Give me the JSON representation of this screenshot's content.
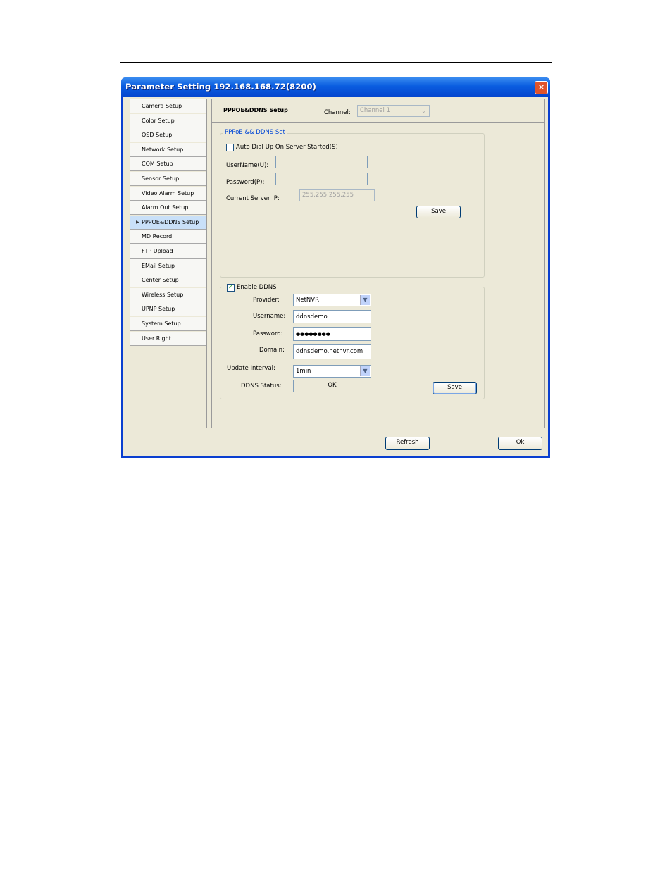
{
  "window": {
    "title": "Parameter Setting 192.168.168.72(8200)"
  },
  "nav": {
    "items": [
      {
        "label": "Camera Setup"
      },
      {
        "label": "Color Setup"
      },
      {
        "label": "OSD Setup"
      },
      {
        "label": "Network Setup"
      },
      {
        "label": "COM Setup"
      },
      {
        "label": "Sensor Setup"
      },
      {
        "label": "Video Alarm Setup"
      },
      {
        "label": "Alarm Out Setup"
      },
      {
        "label": "PPPOE&DDNS Setup"
      },
      {
        "label": "MD Record"
      },
      {
        "label": "FTP Upload"
      },
      {
        "label": "EMail Setup"
      },
      {
        "label": "Center Setup"
      },
      {
        "label": "Wireless Setup"
      },
      {
        "label": "UPNP Setup"
      },
      {
        "label": "System Setup"
      },
      {
        "label": "User Right"
      }
    ],
    "active_index": 8
  },
  "header": {
    "section_title": "PPPOE&DDNS Setup",
    "channel_label": "Channel:",
    "channel_value": "Channel 1"
  },
  "pppoe": {
    "legend": "PPPoE && DDNS Set",
    "auto_dial_label": "Auto Dial Up On Server Started(S)",
    "username_label": "UserName(U):",
    "username_value": "",
    "password_label": "Password(P):",
    "password_value": "",
    "server_ip_label": "Current Server IP:",
    "server_ip_value": "255.255.255.255",
    "save_label": "Save"
  },
  "ddns": {
    "enable_label": "Enable DDNS",
    "enabled": true,
    "provider_label": "Provider:",
    "provider_value": "NetNVR",
    "username_label": "Username:",
    "username_value": "ddnsdemo",
    "password_label": "Password:",
    "password_value": "●●●●●●●●",
    "domain_label": "Domain:",
    "domain_value": "ddnsdemo.netnvr.com",
    "interval_label": "Update Interval:",
    "interval_value": "1min",
    "status_label": "DDNS Status:",
    "status_value": "OK",
    "save_label": "Save"
  },
  "footer": {
    "refresh_label": "Refresh",
    "ok_label": "Ok"
  },
  "colors": {
    "titlebar": "#0a5de0",
    "dialog_bg": "#ece9d8",
    "legend": "#0046d5"
  }
}
